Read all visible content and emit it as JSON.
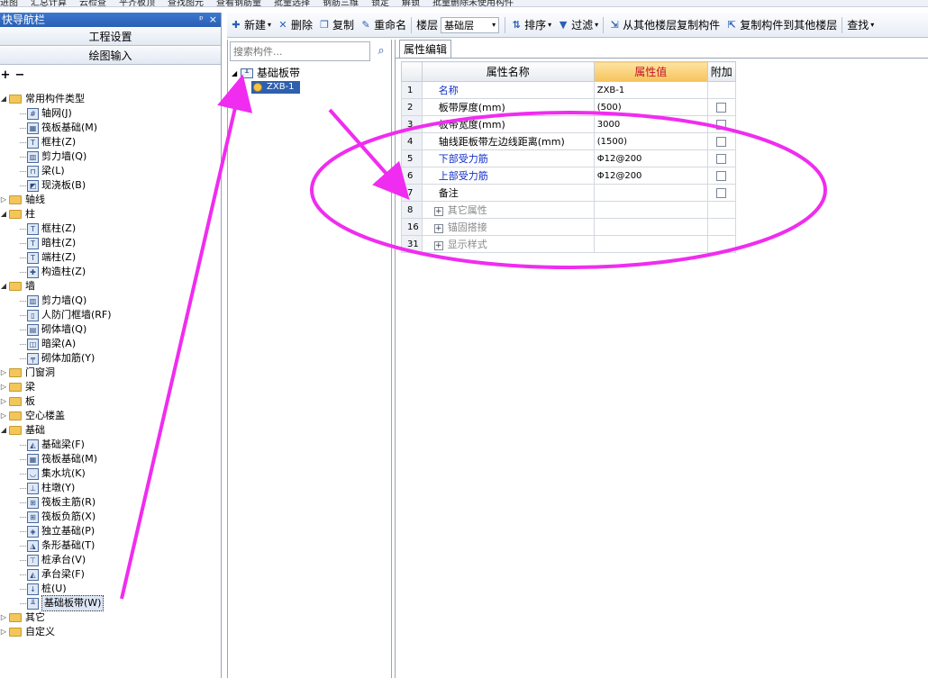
{
  "top_strip": [
    "进图",
    "汇总计算",
    "云检查",
    "平齐板顶",
    "查找图元",
    "查看钢筋量",
    "批量选择",
    "钢筋三维",
    "锁定",
    "解锁",
    "批量删除未使用构件"
  ],
  "nav": {
    "title": "快导航栏",
    "pin": "ᵖ",
    "close": "×",
    "sections": [
      "工程设置",
      "绘图输入"
    ],
    "tools": [
      "+",
      "−"
    ],
    "tree": [
      {
        "kind": "folder",
        "label": "常用构件类型",
        "expanded": true,
        "children": [
          {
            "label": "轴网(J)",
            "icon": "#"
          },
          {
            "label": "筏板基础(M)",
            "icon": "▦"
          },
          {
            "label": "框柱(Z)",
            "icon": "T"
          },
          {
            "label": "剪力墙(Q)",
            "icon": "▥"
          },
          {
            "label": "梁(L)",
            "icon": "⊓"
          },
          {
            "label": "现浇板(B)",
            "icon": "◩"
          }
        ]
      },
      {
        "kind": "folder",
        "label": "轴线",
        "expanded": false,
        "children": []
      },
      {
        "kind": "folder",
        "label": "柱",
        "expanded": true,
        "children": [
          {
            "label": "框柱(Z)",
            "icon": "T"
          },
          {
            "label": "暗柱(Z)",
            "icon": "T"
          },
          {
            "label": "端柱(Z)",
            "icon": "T"
          },
          {
            "label": "构造柱(Z)",
            "icon": "✚"
          }
        ]
      },
      {
        "kind": "folder",
        "label": "墙",
        "expanded": true,
        "children": [
          {
            "label": "剪力墙(Q)",
            "icon": "▥"
          },
          {
            "label": "人防门框墙(RF)",
            "icon": "▯"
          },
          {
            "label": "砌体墙(Q)",
            "icon": "▤"
          },
          {
            "label": "暗梁(A)",
            "icon": "◫"
          },
          {
            "label": "砌体加筋(Y)",
            "icon": "╤"
          }
        ]
      },
      {
        "kind": "folder",
        "label": "门窗洞",
        "expanded": false,
        "children": []
      },
      {
        "kind": "folder",
        "label": "梁",
        "expanded": false,
        "children": []
      },
      {
        "kind": "folder",
        "label": "板",
        "expanded": false,
        "children": []
      },
      {
        "kind": "folder",
        "label": "空心楼盖",
        "expanded": false,
        "children": []
      },
      {
        "kind": "folder",
        "label": "基础",
        "expanded": true,
        "children": [
          {
            "label": "基础梁(F)",
            "icon": "◭"
          },
          {
            "label": "筏板基础(M)",
            "icon": "▦"
          },
          {
            "label": "集水坑(K)",
            "icon": "◡"
          },
          {
            "label": "柱墩(Y)",
            "icon": "⊥"
          },
          {
            "label": "筏板主筋(R)",
            "icon": "⊞"
          },
          {
            "label": "筏板负筋(X)",
            "icon": "⊞"
          },
          {
            "label": "独立基础(P)",
            "icon": "◈"
          },
          {
            "label": "条形基础(T)",
            "icon": "◮"
          },
          {
            "label": "桩承台(V)",
            "icon": "⊤"
          },
          {
            "label": "承台梁(F)",
            "icon": "◭"
          },
          {
            "label": "桩(U)",
            "icon": "↓"
          },
          {
            "label": "基础板带(W)",
            "icon": "╨",
            "selected": true
          }
        ]
      },
      {
        "kind": "folder",
        "label": "其它",
        "expanded": false,
        "children": []
      },
      {
        "kind": "folder",
        "label": "自定义",
        "expanded": false,
        "children": []
      }
    ]
  },
  "toolbar": {
    "new_label": "新建",
    "delete_label": "删除",
    "copy_label": "复制",
    "rename_label": "重命名",
    "floor_label": "楼层",
    "floor_value": "基础层",
    "sort_label": "排序",
    "filter_label": "过滤",
    "copy_from_floor_label": "从其他楼层复制构件",
    "copy_to_floor_label": "复制构件到其他楼层",
    "find_label": "查找"
  },
  "component_list": {
    "search_placeholder": "搜索构件...",
    "group_label": "基础板带",
    "item_label": "ZXB-1"
  },
  "properties": {
    "tab_label": "属性编辑",
    "headers": {
      "name": "属性名称",
      "value": "属性值",
      "extra": "附加"
    },
    "rows": [
      {
        "num": "1",
        "name": "名称",
        "value": "ZXB-1",
        "style": "blue",
        "check": false
      },
      {
        "num": "2",
        "name": "板带厚度(mm)",
        "value": "(500)",
        "style": "normal",
        "check": true
      },
      {
        "num": "3",
        "name": "板带宽度(mm)",
        "value": "3000",
        "style": "normal",
        "check": true
      },
      {
        "num": "4",
        "name": "轴线距板带左边线距离(mm)",
        "value": "(1500)",
        "style": "normal",
        "check": true
      },
      {
        "num": "5",
        "name": "下部受力筋",
        "value": "Φ12@200",
        "style": "blue",
        "check": true
      },
      {
        "num": "6",
        "name": "上部受力筋",
        "value": "Φ12@200",
        "style": "blue",
        "check": true
      },
      {
        "num": "7",
        "name": "备注",
        "value": "",
        "style": "normal",
        "check": true
      },
      {
        "num": "8",
        "name": "其它属性",
        "value": "",
        "style": "group",
        "check": false
      },
      {
        "num": "16",
        "name": "锚固搭接",
        "value": "",
        "style": "group",
        "check": false
      },
      {
        "num": "31",
        "name": "显示样式",
        "value": "",
        "style": "group",
        "check": false
      }
    ]
  },
  "colors": {
    "annotation": "#f02cf0",
    "selection": "#2f5fae",
    "value_header": "#c3122a"
  }
}
